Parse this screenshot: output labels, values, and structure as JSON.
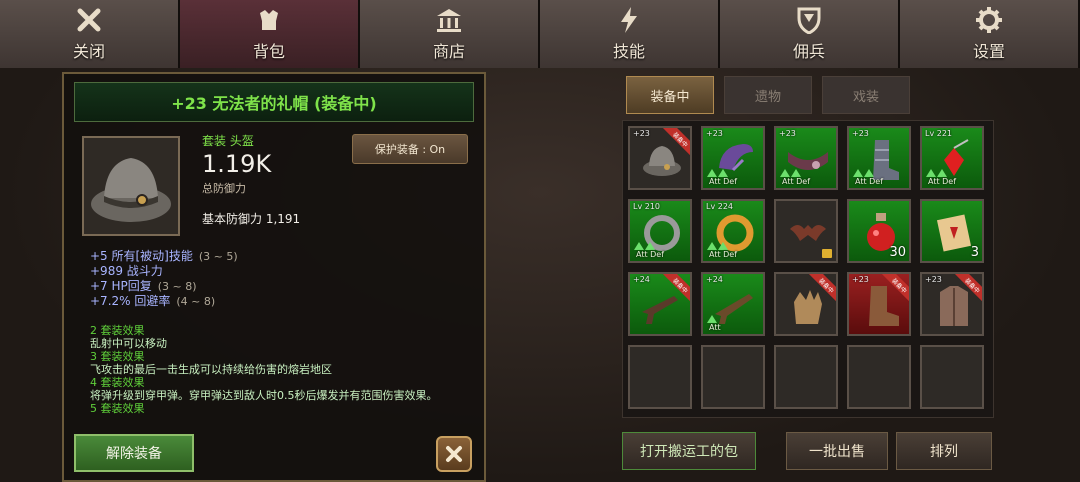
{
  "top_tabs": [
    {
      "label": "关闭",
      "icon": "close-icon"
    },
    {
      "label": "背包",
      "icon": "armor-icon"
    },
    {
      "label": "商店",
      "icon": "bank-icon"
    },
    {
      "label": "技能",
      "icon": "lightning-icon"
    },
    {
      "label": "佣兵",
      "icon": "shield-icon"
    },
    {
      "label": "设置",
      "icon": "gear-icon"
    }
  ],
  "item": {
    "title": "+23 无法者的礼帽 (装备中)",
    "set_type": "套装 头盔",
    "power": "1.19K",
    "power_label": "总防御力",
    "base_def": "基本防御力 1,191",
    "protect_label": "保护装备 : On",
    "stats": [
      {
        "text": "+5 所有[被动]技能",
        "range": "(3 ~ 5)"
      },
      {
        "text": "+989 战斗力",
        "range": ""
      },
      {
        "text": "+7 HP回复",
        "range": "(3 ~ 8)"
      },
      {
        "text": "+7.2% 回避率",
        "range": "(4 ~ 8)"
      }
    ],
    "set_effects": [
      {
        "head": "2 套装效果",
        "text": "乱射中可以移动"
      },
      {
        "head": "3 套装效果",
        "text": "飞攻击的最后一击生成可以持续给伤害的熔岩地区"
      },
      {
        "head": "4 套装效果",
        "text": "将弹升级到穿甲弹。穿甲弹达到敌人时0.5秒后爆发并有范围伤害效果。"
      },
      {
        "head": "5 套装效果",
        "text": ""
      }
    ],
    "unequip_label": "解除装备"
  },
  "equip_tabs": [
    "装备中",
    "遗物",
    "戏装"
  ],
  "slots": [
    {
      "lvl": "+23",
      "bg": "b",
      "ribbon": "装备中",
      "icon": "hat-icon",
      "ad": "",
      "arrows": 0,
      "count": ""
    },
    {
      "lvl": "+23",
      "bg": "g",
      "ribbon": "",
      "icon": "shoulder-icon",
      "ad": "Att Def",
      "arrows": 2,
      "count": ""
    },
    {
      "lvl": "+23",
      "bg": "g",
      "ribbon": "",
      "icon": "belt-icon",
      "ad": "Att Def",
      "arrows": 2,
      "count": ""
    },
    {
      "lvl": "+23",
      "bg": "g",
      "ribbon": "",
      "icon": "boot-icon",
      "ad": "Att Def",
      "arrows": 2,
      "count": ""
    },
    {
      "lvl": "Lv 221",
      "bg": "g",
      "ribbon": "",
      "icon": "amulet-icon",
      "ad": "Att Def",
      "arrows": 2,
      "count": ""
    },
    {
      "lvl": "Lv 210",
      "bg": "g",
      "ribbon": "",
      "icon": "ring-icon",
      "ad": "Att Def",
      "arrows": 2,
      "count": ""
    },
    {
      "lvl": "Lv 224",
      "bg": "g",
      "ribbon": "",
      "icon": "gold-ring-icon",
      "ad": "Att Def",
      "arrows": 2,
      "count": ""
    },
    {
      "lvl": "",
      "bg": "b",
      "ribbon": "",
      "icon": "bat-icon",
      "ad": "",
      "arrows": 0,
      "count": "",
      "lock": true
    },
    {
      "lvl": "",
      "bg": "g",
      "ribbon": "",
      "icon": "potion-icon",
      "ad": "",
      "arrows": 0,
      "count": "30"
    },
    {
      "lvl": "",
      "bg": "g",
      "ribbon": "",
      "icon": "scroll-icon",
      "ad": "",
      "arrows": 0,
      "count": "3"
    },
    {
      "lvl": "+24",
      "bg": "g",
      "ribbon": "装备中",
      "icon": "gun-icon",
      "ad": "",
      "arrows": 0,
      "count": ""
    },
    {
      "lvl": "+24",
      "bg": "g",
      "ribbon": "",
      "icon": "rifle-icon",
      "ad": "Att",
      "arrows": 1,
      "count": ""
    },
    {
      "lvl": "",
      "bg": "b",
      "ribbon": "装备中",
      "icon": "glove-icon",
      "ad": "",
      "arrows": 0,
      "count": ""
    },
    {
      "lvl": "+23",
      "bg": "r",
      "ribbon": "装备中",
      "icon": "boots-icon",
      "ad": "",
      "arrows": 0,
      "count": ""
    },
    {
      "lvl": "+23",
      "bg": "b",
      "ribbon": "装备中",
      "icon": "coat-icon",
      "ad": "",
      "arrows": 0,
      "count": ""
    },
    {
      "lvl": "",
      "bg": "b",
      "ribbon": "",
      "icon": "",
      "ad": "",
      "arrows": 0,
      "count": ""
    },
    {
      "lvl": "",
      "bg": "b",
      "ribbon": "",
      "icon": "",
      "ad": "",
      "arrows": 0,
      "count": ""
    },
    {
      "lvl": "",
      "bg": "b",
      "ribbon": "",
      "icon": "",
      "ad": "",
      "arrows": 0,
      "count": ""
    },
    {
      "lvl": "",
      "bg": "b",
      "ribbon": "",
      "icon": "",
      "ad": "",
      "arrows": 0,
      "count": ""
    },
    {
      "lvl": "",
      "bg": "b",
      "ribbon": "",
      "icon": "",
      "ad": "",
      "arrows": 0,
      "count": ""
    }
  ],
  "bottom": {
    "open_porter": "打开搬运工的包",
    "bulk_sell": "一批出售",
    "sort": "排列"
  }
}
